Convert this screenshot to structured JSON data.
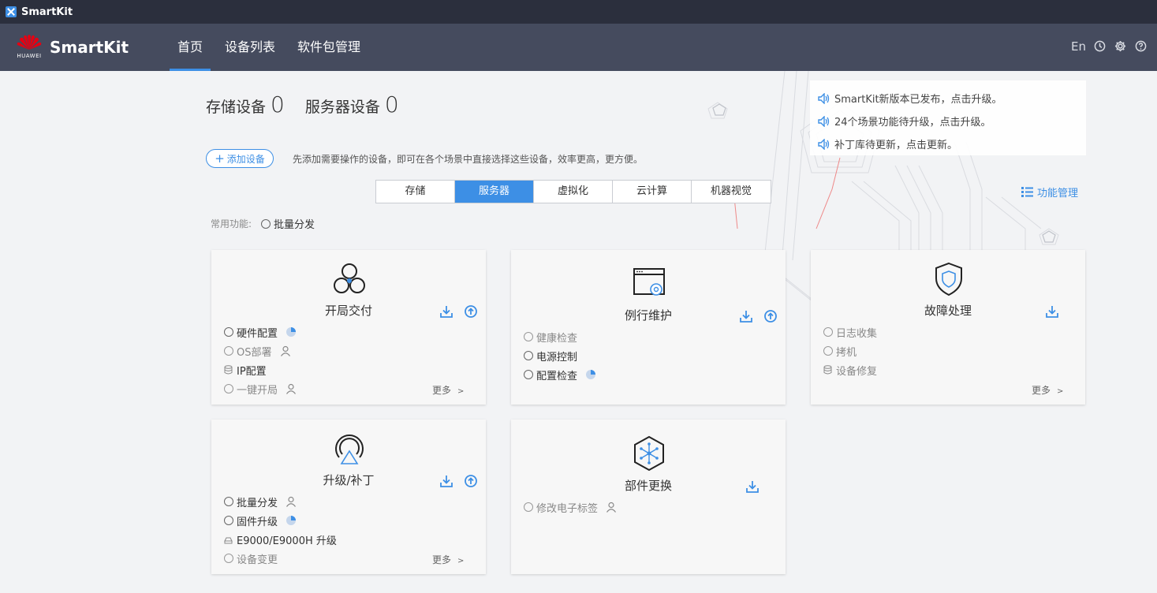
{
  "window": {
    "title": "SmartKit"
  },
  "header": {
    "logo_text": "HUAWEI",
    "app_name": "SmartKit",
    "nav": [
      {
        "label": "首页",
        "active": true
      },
      {
        "label": "设备列表",
        "active": false
      },
      {
        "label": "软件包管理",
        "active": false
      }
    ],
    "tools": {
      "lang": "En"
    }
  },
  "counters": {
    "storage_label": "存储设备",
    "storage_count": "0",
    "server_label": "服务器设备",
    "server_count": "0"
  },
  "notices": [
    "SmartKit新版本已发布，点击升级。",
    "24个场景功能待升级，点击升级。",
    "补丁库待更新，点击更新。"
  ],
  "add_device": {
    "label": "添加设备",
    "hint": "先添加需要操作的设备，即可在各个场景中直接选择这些设备，效率更高，更方便。"
  },
  "tabs": [
    {
      "label": "存储",
      "active": false
    },
    {
      "label": "服务器",
      "active": true
    },
    {
      "label": "虚拟化",
      "active": false
    },
    {
      "label": "云计算",
      "active": false
    },
    {
      "label": "机器视觉",
      "active": false
    }
  ],
  "func_mgmt": "功能管理",
  "common": {
    "label": "常用功能:",
    "item": "批量分发"
  },
  "cards": {
    "kaiju": {
      "title": "开局交付",
      "items": [
        "硬件配置",
        "OS部署",
        "IP配置",
        "一键开局"
      ],
      "more": "更多"
    },
    "liweihu": {
      "title": "例行维护",
      "items": [
        "健康检查",
        "电源控制",
        "配置检查"
      ]
    },
    "guzhang": {
      "title": "故障处理",
      "items": [
        "日志收集",
        "拷机",
        "设备修复"
      ],
      "more": "更多"
    },
    "shengji": {
      "title": "升级/补丁",
      "items": [
        "批量分发",
        "固件升级",
        "E9000/E9000H 升级",
        "设备变更"
      ],
      "more": "更多"
    },
    "bujian": {
      "title": "部件更换",
      "items": [
        "修改电子标签"
      ]
    }
  },
  "colors": {
    "accent": "#3d8fe5",
    "header": "#454b5e",
    "titlebar": "#2b2f3d"
  }
}
